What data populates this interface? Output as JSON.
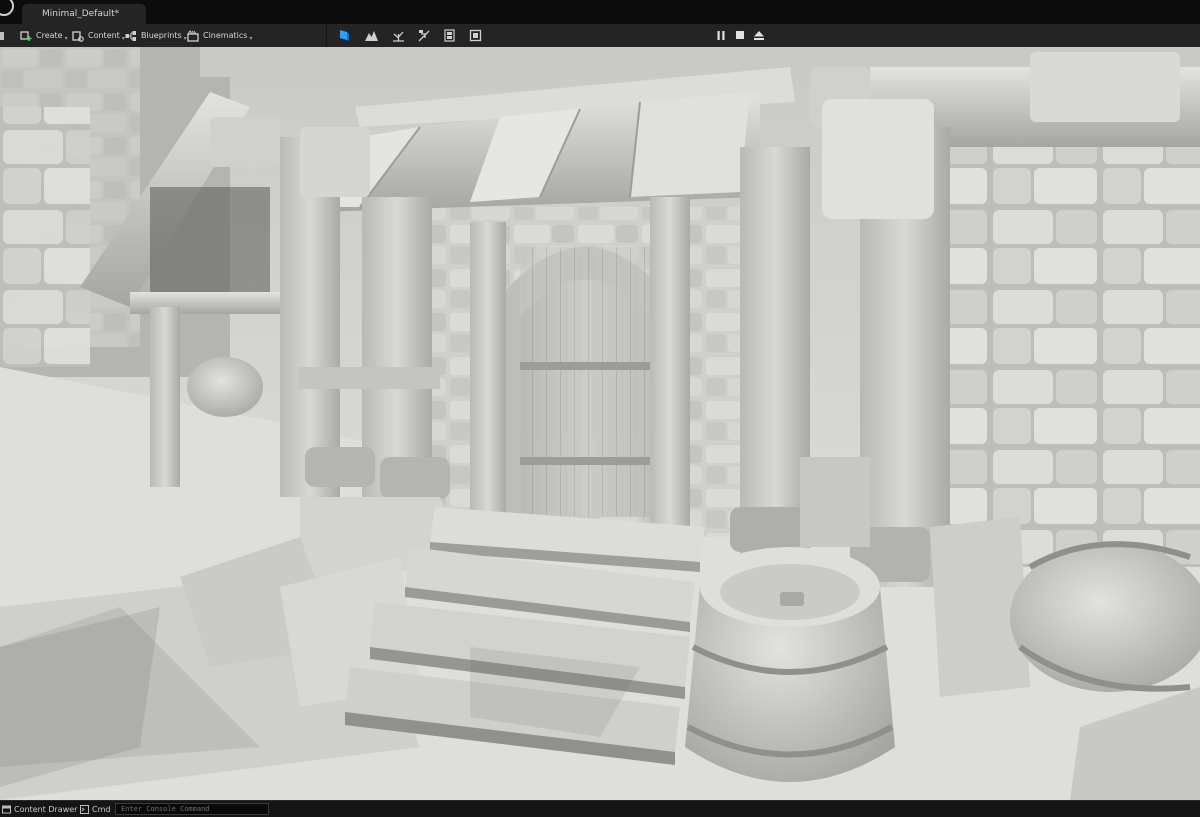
{
  "window": {
    "tab_title": "Minimal_Default*"
  },
  "toolbar": {
    "items": [
      {
        "label": "Create",
        "icon": "create-icon"
      },
      {
        "label": "Content",
        "icon": "content-icon"
      },
      {
        "label": "Blueprints",
        "icon": "blueprints-icon"
      },
      {
        "label": "Cinematics",
        "icon": "cinematics-icon"
      }
    ],
    "mode_icons": [
      "select-mode-icon",
      "landscape-mode-icon",
      "foliage-mode-icon",
      "mesh-paint-mode-icon",
      "fracture-mode-icon",
      "modeling-mode-icon"
    ],
    "play_controls": [
      "pause-icon",
      "stop-icon",
      "eject-icon"
    ]
  },
  "viewport": {
    "scene": "medieval-building-doorway-clay-render"
  },
  "statusbar": {
    "content_drawer_label": "Content Drawer",
    "cmd_label": "Cmd",
    "console_placeholder": "Enter Console Command"
  },
  "colors": {
    "accent_blue": "#2a9fff",
    "toolbar_bg": "#242424",
    "titlebar_bg": "#0c0c0c",
    "viewport_clay": "#d6d6d3"
  }
}
